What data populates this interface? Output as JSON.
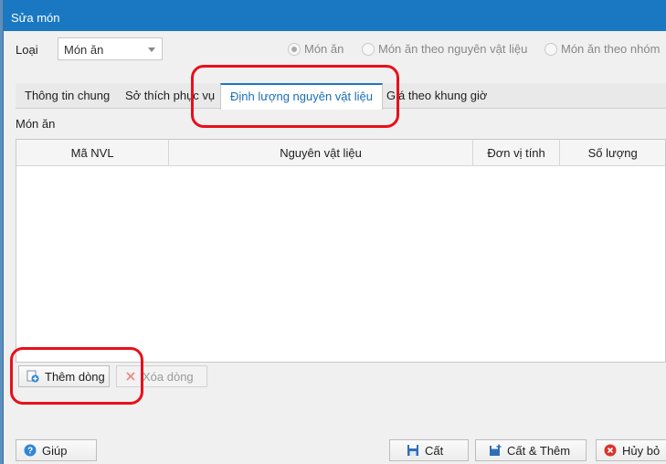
{
  "window": {
    "title": "Sửa món"
  },
  "loai": {
    "label": "Loại",
    "value": "Món ăn",
    "radios": [
      {
        "label": "Món ăn",
        "checked": true
      },
      {
        "label": "Món ăn theo nguyên vật liệu",
        "checked": false
      },
      {
        "label": "Món ăn theo nhóm",
        "checked": false
      }
    ]
  },
  "tabs": [
    {
      "label": "Thông tin chung"
    },
    {
      "label": "Sở thích phục vụ"
    },
    {
      "label": "Định lượng nguyên vật liệu",
      "active": true
    },
    {
      "label": "Giá theo khung giờ"
    }
  ],
  "section_title": "Món ăn",
  "grid": {
    "columns": [
      "Mã NVL",
      "Nguyên vật liệu",
      "Đơn vị tính",
      "Số lượng"
    ],
    "rows": []
  },
  "row_buttons": {
    "add": "Thêm dòng",
    "delete": "Xóa dòng"
  },
  "footer": {
    "help": "Giúp",
    "save": "Cất",
    "save_add": "Cất & Thêm",
    "cancel": "Hủy bỏ"
  },
  "colors": {
    "title_bar": "#1a78c2",
    "highlight": "#e8101a"
  }
}
